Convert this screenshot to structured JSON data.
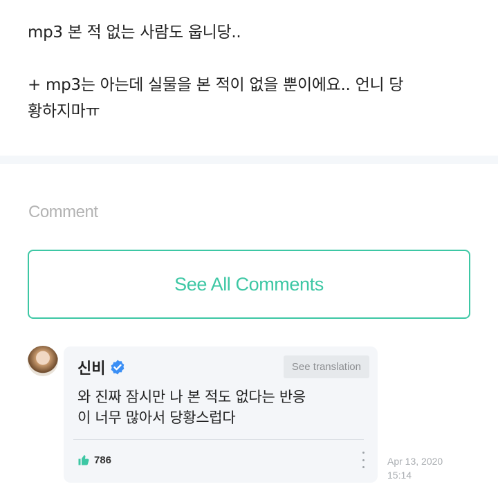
{
  "post": {
    "line1": "mp3 본 적 없는 사람도 웁니당..",
    "line2": "+ mp3는 아는데 실물을 본 적이 없을 뿐이에요.. 언니 당",
    "line3": "황하지마ㅠ"
  },
  "comments_section": {
    "heading": "Comment",
    "see_all_label": "See All Comments"
  },
  "comment": {
    "author": "신비",
    "verified_icon": "verified-badge-icon",
    "translate_label": "See translation",
    "text_line1": "와 진짜 잠시만 나 본 적도 없다는 반응",
    "text_line2": "이 너무 많아서 당황스럽다",
    "like_icon": "thumbs-up-icon",
    "likes": "786",
    "more_icon": "more-vertical-icon",
    "date": "Apr 13, 2020",
    "time": "15:14"
  },
  "colors": {
    "accent": "#3dc7a4",
    "verified": "#3b8ff5",
    "card_bg": "#f4f6f9"
  }
}
